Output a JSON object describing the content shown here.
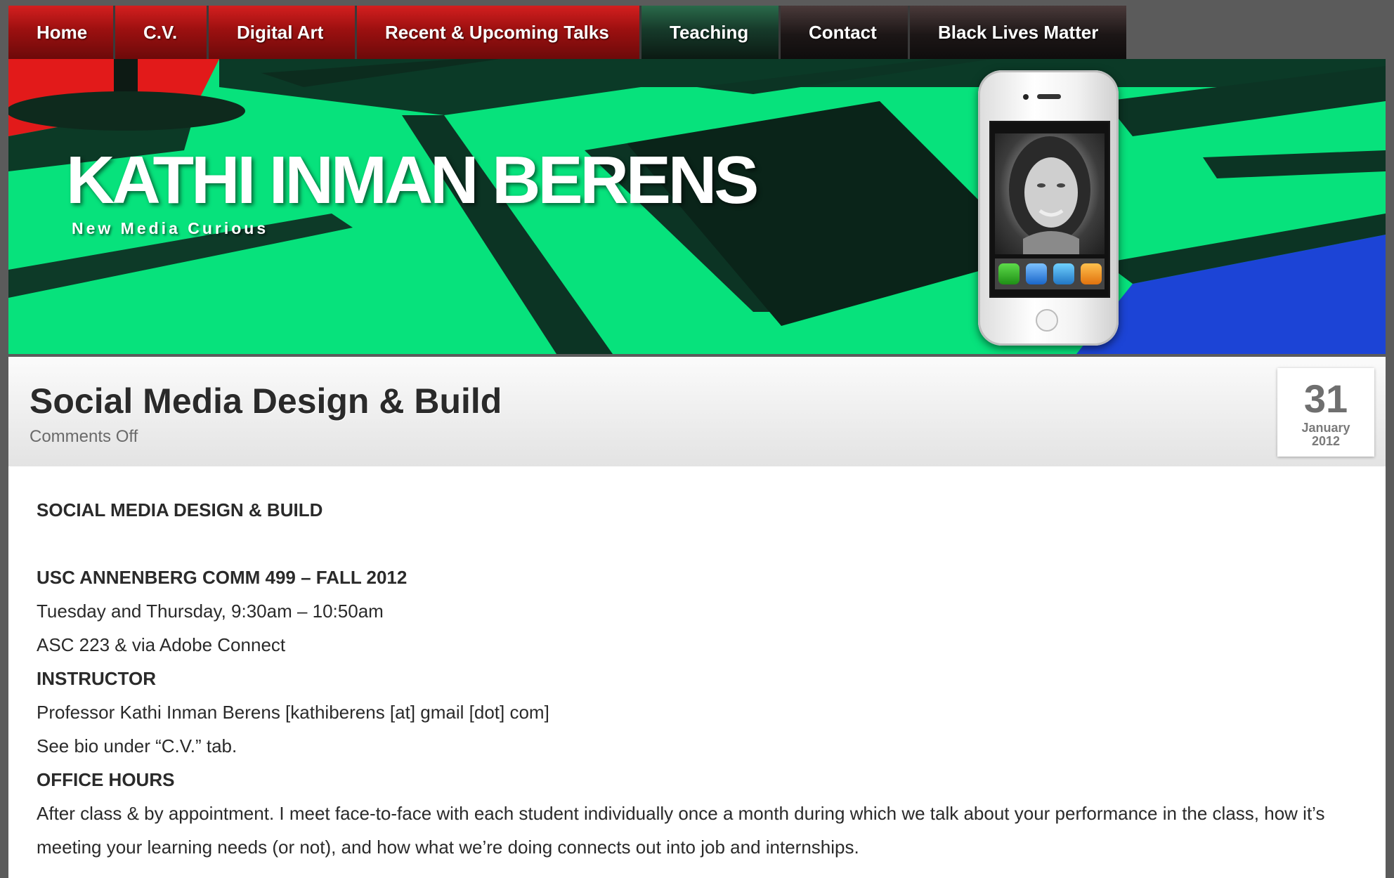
{
  "nav": {
    "items": [
      {
        "label": "Home"
      },
      {
        "label": "C.V."
      },
      {
        "label": "Digital Art"
      },
      {
        "label": "Recent & Upcoming Talks"
      },
      {
        "label": "Teaching"
      },
      {
        "label": "Contact"
      },
      {
        "label": "Black Lives Matter"
      }
    ]
  },
  "header": {
    "title": "KATHI INMAN BERENS",
    "tagline": "New Media Curious"
  },
  "post": {
    "title": "Social Media Design & Build",
    "comments": "Comments Off",
    "date": {
      "day": "31",
      "month": "January",
      "year": "2012"
    }
  },
  "content": {
    "heading": "SOCIAL MEDIA DESIGN & BUILD",
    "course": "USC ANNENBERG COMM 499 – FALL 2012",
    "schedule": "Tuesday and Thursday, 9:30am – 10:50am",
    "location": "ASC 223 & via Adobe Connect",
    "instructor_heading": "INSTRUCTOR",
    "instructor": "Professor Kathi Inman Berens [kathiberens [at] gmail [dot] com]",
    "bio_note": "See bio under “C.V.” tab.",
    "office_hours_heading": "OFFICE HOURS",
    "office_hours": "After class & by appointment. I meet face-to-face with each student individually once a month during which we talk about your performance in the class, how it’s meeting your learning needs (or not), and how what we’re doing connects out into job and internships."
  },
  "colors": {
    "nav_red": "#b31414",
    "header_green": "#06e07a",
    "page_bg": "#5b5b5b",
    "text": "#2a2a2a"
  }
}
